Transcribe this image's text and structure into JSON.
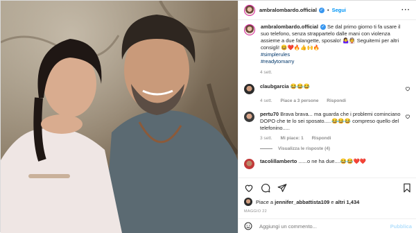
{
  "post": {
    "username": "ambralombardo.official",
    "follow_label": "Segui",
    "caption": "Se dal primo giorno ti fa usare il suo telefono, senza strappartelo dalle mani con violenza assieme a due falangette, sposalo! 🤷‍♀️👰 Seguitemi per altri consigli! 😆❤️🔥👍🙌🔥",
    "hashtags": [
      "#simplerules",
      "#readytomarry"
    ],
    "caption_time": "4 sett."
  },
  "comments": [
    {
      "user": "claubgarcia",
      "text": "😂😂😂",
      "time": "4 sett.",
      "likes": "Piace a 3 persone",
      "reply": "Rispondi"
    },
    {
      "user": "pertu70",
      "text": "Brava brava... ma guarda che i problemi cominciano DOPO che te lo sei sposato.....😂😂😂 compreso quello del telefonino.....",
      "time": "3 sett.",
      "likes": "Mi piace: 1",
      "reply": "Rispondi",
      "view_replies": "Visualizza le risposte (4)"
    },
    {
      "user": "tacolillamberto",
      "text": "......o ne ha due....😂😂❤️❤️"
    }
  ],
  "likes": {
    "prefix": "Piace a",
    "user": "jennifer_abbattista109",
    "connector": "e",
    "others": "altri 1,434"
  },
  "date": "MAGGIO 22",
  "add_comment": {
    "placeholder": "Aggiungi un commento...",
    "publish": "Pubblica"
  },
  "colors": {
    "accent": "#0095f6",
    "verified": "#3897f0",
    "like_red": "#ed4956"
  },
  "icons": [
    "more-icon",
    "heart-icon",
    "comment-icon",
    "share-icon",
    "bookmark-icon",
    "emoji-icon",
    "verified-icon"
  ]
}
